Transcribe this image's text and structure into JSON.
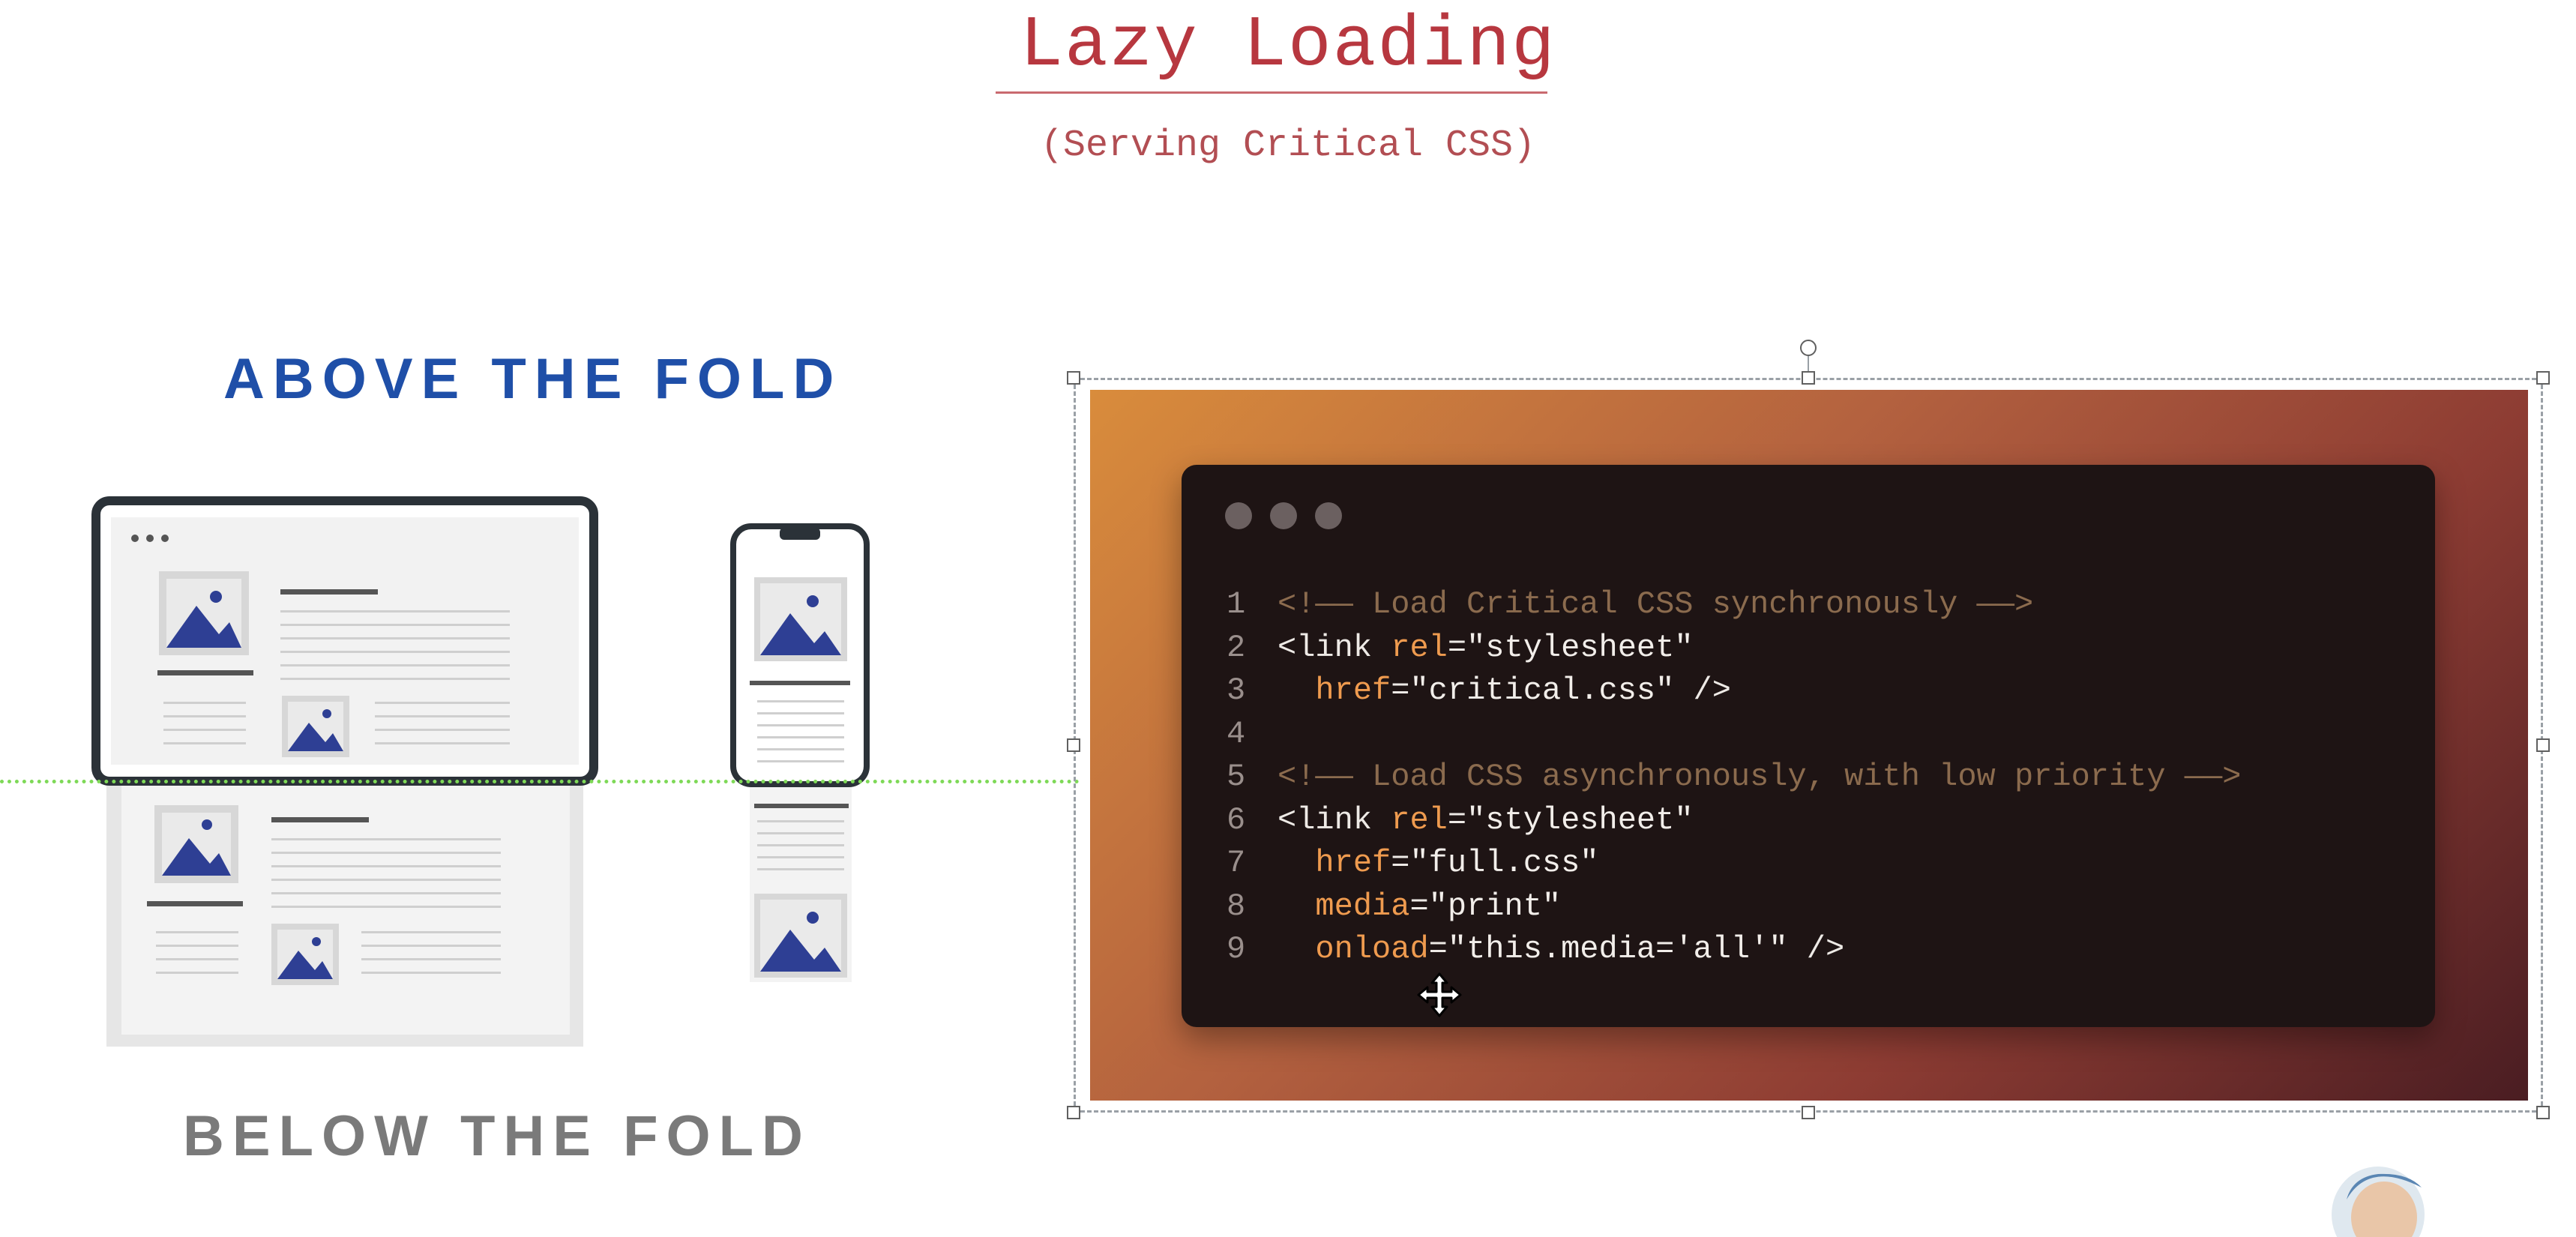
{
  "slide": {
    "title": "Lazy Loading",
    "subtitle": "(Serving Critical CSS)",
    "above_label": "ABOVE THE FOLD",
    "below_label": "BELOW THE FOLD"
  },
  "colors": {
    "title": "#b7373f",
    "above_label": "#1f4fa8",
    "below_label": "#7a7a7a",
    "fold_line": "#7ed957",
    "illustration_accent": "#2e3f94"
  },
  "code": {
    "lines": [
      {
        "n": "1",
        "comment": "<!—— Load Critical CSS synchronously ——>"
      },
      {
        "n": "2",
        "parts": [
          [
            "tag",
            "<link "
          ],
          [
            "attr",
            "rel"
          ],
          [
            "tag",
            "="
          ],
          [
            "str",
            "\"stylesheet\""
          ]
        ]
      },
      {
        "n": "3",
        "parts": [
          [
            "tag",
            "  "
          ],
          [
            "attr",
            "href"
          ],
          [
            "tag",
            "="
          ],
          [
            "str",
            "\"critical.css\""
          ],
          [
            "tag",
            " />"
          ]
        ]
      },
      {
        "n": "4",
        "parts": []
      },
      {
        "n": "5",
        "comment": "<!—— Load CSS asynchronously, with low priority ——>"
      },
      {
        "n": "6",
        "parts": [
          [
            "tag",
            "<link "
          ],
          [
            "attr",
            "rel"
          ],
          [
            "tag",
            "="
          ],
          [
            "str",
            "\"stylesheet\""
          ]
        ]
      },
      {
        "n": "7",
        "parts": [
          [
            "tag",
            "  "
          ],
          [
            "attr",
            "href"
          ],
          [
            "tag",
            "="
          ],
          [
            "str",
            "\"full.css\""
          ]
        ]
      },
      {
        "n": "8",
        "parts": [
          [
            "tag",
            "  "
          ],
          [
            "attr",
            "media"
          ],
          [
            "tag",
            "="
          ],
          [
            "str",
            "\"print\""
          ]
        ]
      },
      {
        "n": "9",
        "parts": [
          [
            "tag",
            "  "
          ],
          [
            "attr",
            "onload"
          ],
          [
            "tag",
            "="
          ],
          [
            "str",
            "\"this.media='all'\""
          ],
          [
            "tag",
            " />"
          ]
        ]
      }
    ]
  },
  "icons": {
    "window_dots": "window-control-dots-icon",
    "cursor": "move-cursor-icon",
    "rotate": "rotate-handle-icon"
  }
}
